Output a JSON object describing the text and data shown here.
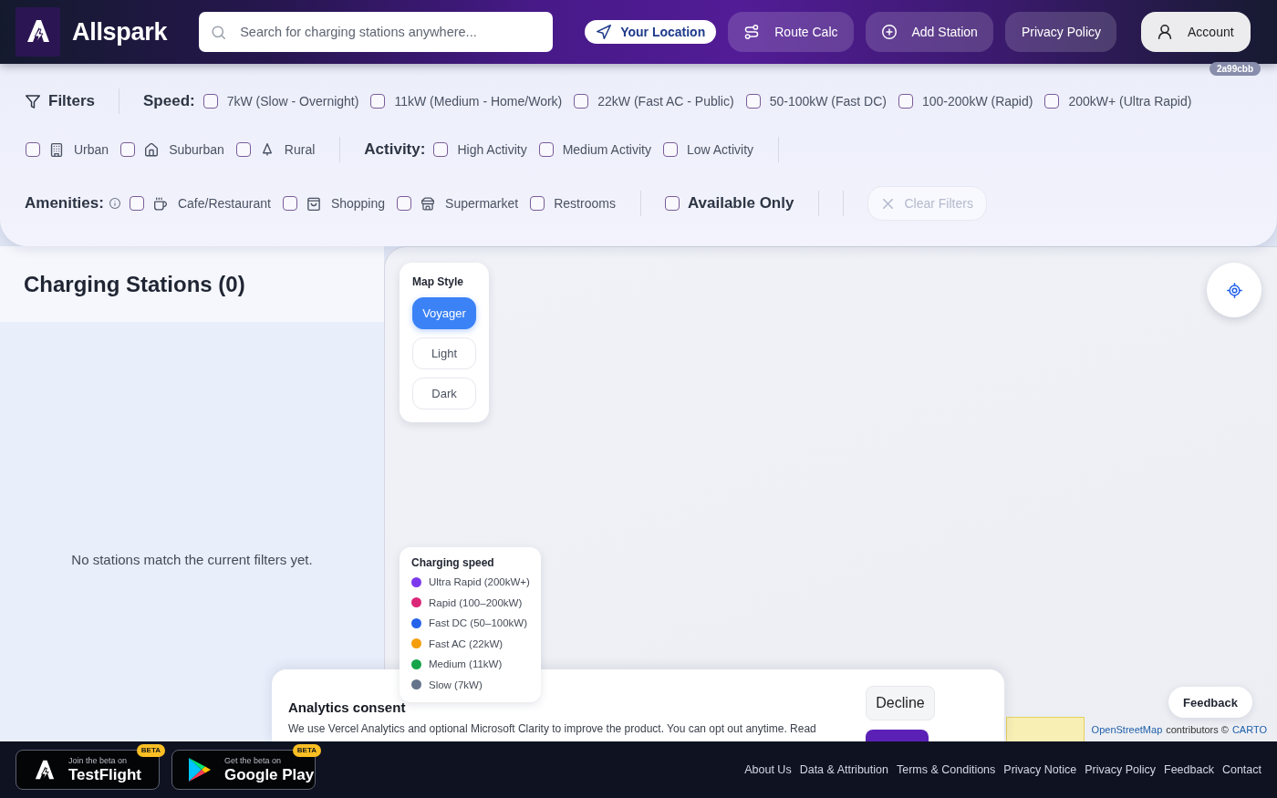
{
  "header": {
    "brand": "Allspark",
    "search": {
      "placeholder": "Search for charging stations anywhere..."
    },
    "nav": [
      {
        "kind": "location",
        "label": "Your Location"
      },
      {
        "kind": "route",
        "label": "Route Calc"
      },
      {
        "kind": "add",
        "label": "Add Station"
      },
      {
        "kind": "plain",
        "label": "Privacy Policy"
      },
      {
        "kind": "account",
        "label": "Account"
      }
    ]
  },
  "version": "2a99cbb",
  "filters": {
    "title": "Filters",
    "speed": {
      "label": "Speed:",
      "options": [
        {
          "label": "7kW (Slow - Overnight)",
          "checked": false
        },
        {
          "label": "11kW (Medium - Home/Work)",
          "checked": false
        },
        {
          "label": "22kW (Fast AC - Public)",
          "checked": false
        },
        {
          "label": "50-100kW (Fast DC)",
          "checked": false
        },
        {
          "label": "100-200kW (Rapid)",
          "checked": false
        },
        {
          "label": "200kW+ (Ultra Rapid)",
          "checked": false
        }
      ]
    },
    "area": {
      "options": [
        {
          "kind": "urban",
          "label": "Urban",
          "checked": false
        },
        {
          "kind": "suburban",
          "label": "Suburban",
          "checked": false
        },
        {
          "kind": "rural",
          "label": "Rural",
          "checked": false
        }
      ]
    },
    "activity": {
      "label": "Activity:",
      "options": [
        {
          "label": "High Activity",
          "checked": false
        },
        {
          "label": "Medium Activity",
          "checked": false
        },
        {
          "label": "Low Activity",
          "checked": false
        }
      ]
    },
    "amenities": {
      "label": "Amenities:",
      "options": [
        {
          "kind": "cafe",
          "label": "Cafe/Restaurant",
          "checked": false
        },
        {
          "kind": "shopping",
          "label": "Shopping",
          "checked": false
        },
        {
          "kind": "supermarket",
          "label": "Supermarket",
          "checked": false
        },
        {
          "kind": "restrooms",
          "label": "Restrooms",
          "checked": false
        }
      ]
    },
    "available_only": {
      "label": "Available Only",
      "checked": false
    },
    "clear": {
      "label": "Clear Filters",
      "disabled": true
    }
  },
  "stations": {
    "title": "Charging Stations (0)",
    "empty_message": "No stations match the current filters yet."
  },
  "map": {
    "style_picker": {
      "title": "Map Style",
      "options": [
        {
          "label": "Voyager",
          "selected": true
        },
        {
          "label": "Light",
          "selected": false
        },
        {
          "label": "Dark",
          "selected": false
        }
      ]
    },
    "legend": {
      "title": "Charging speed",
      "items": [
        {
          "label": "Ultra Rapid (200kW+)",
          "color": "#7c3aed"
        },
        {
          "label": "Rapid (100–200kW)",
          "color": "#db2777"
        },
        {
          "label": "Fast DC (50–100kW)",
          "color": "#2563eb"
        },
        {
          "label": "Fast AC (22kW)",
          "color": "#f59e0b"
        },
        {
          "label": "Medium (11kW)",
          "color": "#16a34a"
        },
        {
          "label": "Slow (7kW)",
          "color": "#64748b"
        }
      ]
    },
    "feedback": "Feedback",
    "attribution": [
      {
        "kind": "link",
        "text": "OpenStreetMap"
      },
      {
        "kind": "text",
        "text": "contributors ©"
      },
      {
        "kind": "link",
        "text": "CARTO"
      }
    ]
  },
  "consent": {
    "title": "Analytics consent",
    "text": "We use Vercel Analytics and optional Microsoft Clarity to improve the product. You can opt out anytime. Read",
    "decline": "Decline"
  },
  "footer": {
    "badges": [
      {
        "kind": "testflight",
        "caption": "Join the beta on",
        "store": "TestFlight",
        "tag": "BETA"
      },
      {
        "kind": "google-play",
        "caption": "Get the beta on",
        "store": "Google Play",
        "tag": "BETA"
      }
    ],
    "links": [
      "About Us",
      "Data & Attribution",
      "Terms & Conditions",
      "Privacy Notice",
      "Privacy Policy",
      "Feedback",
      "Contact"
    ]
  }
}
